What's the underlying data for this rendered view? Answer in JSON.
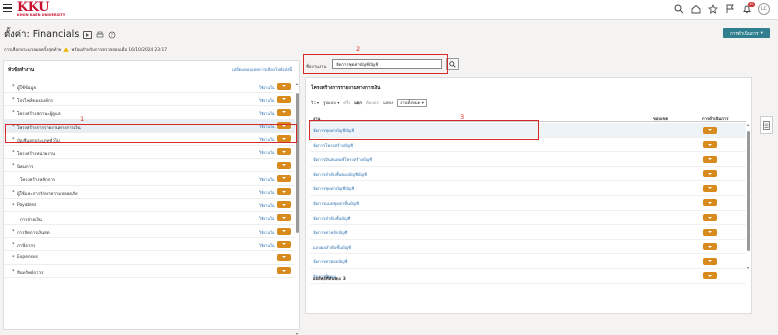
{
  "app": {
    "logo_text": "KKU",
    "logo_subtitle": "KHON KAEN UNIVERSITY",
    "user_initials": "LC",
    "notification_count": "10",
    "icons": [
      "hamburger-icon",
      "search-icon",
      "home-icon",
      "star-icon",
      "flag-icon",
      "bell-icon"
    ]
  },
  "header": {
    "title": "ตั้งค่า: Financials",
    "actions_label": "การดำเนินการ",
    "status_text": "การเลือกประมวลผลครั้งสุดท้าย",
    "status_date": "พร้อมสำหรับการตรวจสอบเมื่อ 16/10/2024 23:17"
  },
  "left_panel": {
    "heading": "หัวข้อทำงาน",
    "show_all_link": "เปลี่ยนขอบเขตการเลือกไปยังส่งนี้",
    "tasks": [
      {
        "name": "ผู้ใช้ข้อมูล",
        "status": "ใช้งานใน",
        "required": true,
        "indent": false
      },
      {
        "name": "โปรไฟล์ขององค์กร",
        "status": "ใช้งานใน",
        "required": true,
        "indent": false
      },
      {
        "name": "โครงสร้างสถานะผู้ดูแล",
        "status": "ใช้งานใน",
        "required": true,
        "indent": false
      },
      {
        "name": "โครงสร้างการรายงานทางการเงิน",
        "status": "ใช้งานใน",
        "required": true,
        "indent": false
      },
      {
        "name": "บัญชีแยกประเภททั่วไป",
        "status": "ใช้งานใน",
        "required": true,
        "indent": false
      },
      {
        "name": "โครงสร้างหน่วยงาน",
        "status": "ใช้งานใน",
        "required": true,
        "indent": false
      },
      {
        "name": "นิคมการ",
        "status": "",
        "required": true,
        "indent": false
      },
      {
        "name": "โครงสร้างหลักการ",
        "status": "ใช้งานใน",
        "required": false,
        "indent": true
      },
      {
        "name": "ผู้ใช้และการรักษาความปลอดภัย",
        "status": "ใช้งานใน",
        "required": true,
        "indent": false
      },
      {
        "name": "Payables",
        "status": "ใช้งานใน",
        "required": true,
        "indent": false
      },
      {
        "name": "การจ่ายเงิน",
        "status": "ใช้งานใน",
        "required": false,
        "indent": true
      },
      {
        "name": "การจัดการเงินสด",
        "status": "ใช้งานใน",
        "required": true,
        "indent": false
      },
      {
        "name": "ภาษีอากร",
        "status": "ใช้งานใน",
        "required": true,
        "indent": false
      },
      {
        "name": "Expenses",
        "status": "",
        "required": true,
        "indent": false
      },
      {
        "name": "สินทรัพย์ถาวร",
        "status": "",
        "required": true,
        "indent": false
      }
    ]
  },
  "search": {
    "label": "ชื่องานงาน",
    "value": "จัดการชุดค่าบัญชีบัญชี"
  },
  "right_panel": {
    "title": "โครงสร้างการรายงานทางการเงิน",
    "toolbar": {
      "view": "วิว",
      "format": "รูปแบบ",
      "freeze": "ตรึง",
      "wrap": "แยก",
      "detach": "ตัดแยก",
      "show_label": "แสดง",
      "show_value": "งานทั้งหมด"
    },
    "columns": {
      "task": "งาน",
      "scope": "ขอบเขต",
      "action": "การดำเนินการ"
    },
    "rows": [
      "จัดการชุดค่าบัญชีบัญชี",
      "จัดการโครงสร้างบัญชี",
      "จัดการอินสแตนซ์โครงสร้างบัญชี",
      "จัดการลำดับชั้นของบัญชีบัญชี",
      "จัดการชุดค่าบัญชีบัญชี",
      "จัดการแมปชุดค่าชั้นบัญชี",
      "จัดการลำดับชั้นบัญชี",
      "จัดการค่าหลักบัญชี",
      "แถบผลลำดับชั้นบัญชี",
      "จัดการค่าตอบบัญชี",
      "จัดการปี่อนน"
    ],
    "result_count": "ผลลัพธ์ที่ค้นพบ: 3"
  },
  "annotations": {
    "label_1": "1",
    "label_2": "2",
    "label_3": "3",
    "color": "#d42a2a"
  },
  "colors": {
    "accent_orange": "#d88a1c",
    "primary_teal": "#2f7f8f",
    "link_blue": "#2a6fb1",
    "brand_red": "#c8102e"
  }
}
